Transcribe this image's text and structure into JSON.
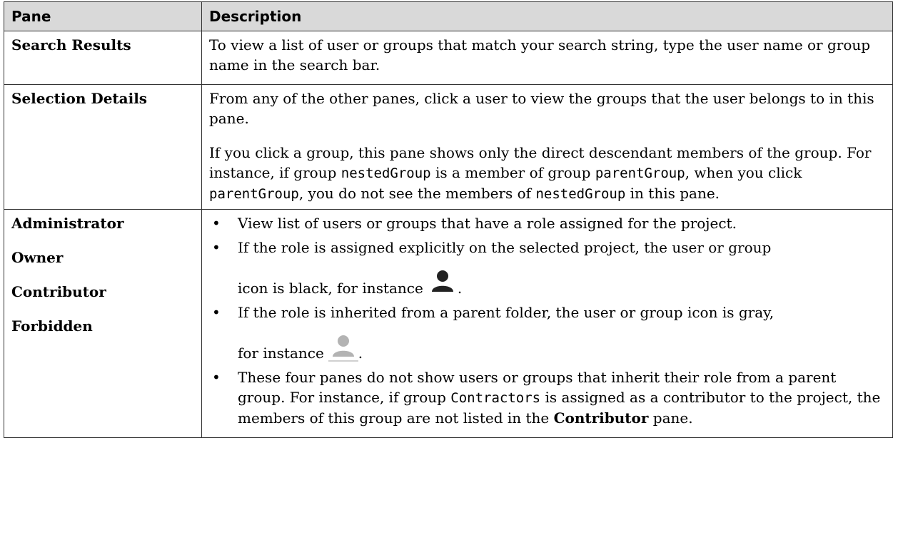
{
  "headers": {
    "pane": "Pane",
    "description": "Description"
  },
  "rows": {
    "search": {
      "pane": "Search Results",
      "description": "To view a list of user or groups that match your search string, type the user name or group name in the search bar."
    },
    "selection": {
      "pane": "Selection Details",
      "p1": "From any of the other panes, click a user to view the groups that the user belongs to in this pane.",
      "p2_a": "If you click a group, this pane shows only the direct descendant members of the group. For instance, if group ",
      "p2_code1": "nestedGroup",
      "p2_b": " is a member of group ",
      "p2_code2": "parentGroup",
      "p2_c": ", when you click ",
      "p2_code3": "parentGroup",
      "p2_d": ", you do not see the members of ",
      "p2_code4": "nestedGroup",
      "p2_e": " in this pane."
    },
    "roles": {
      "panes": [
        "Administrator",
        "Owner",
        "Contributor",
        "Forbidden"
      ],
      "b1": "View list of users or groups that have a role assigned for the project.",
      "b2_a": "If the role is assigned explicitly on the selected project, the user or group",
      "b2_b": "icon is black, for instance",
      "b2_end": ".",
      "b3_a": "If the role is inherited from a parent folder, the user or group icon is gray,",
      "b3_b": "for instance",
      "b3_end": ".",
      "b4_a": "These four panes do not show users or groups that inherit their role from a parent group. For instance, if group ",
      "b4_code": "Contractors",
      "b4_b": " is assigned as a contributor to the project, the members of this group are not listed in the ",
      "b4_bold": "Contributor",
      "b4_c": " pane."
    }
  },
  "icons": {
    "explicit": "user-black-icon",
    "inherited": "user-gray-icon"
  },
  "colors": {
    "header_bg": "#d9d9d9",
    "icon_black": "#222222",
    "icon_gray": "#b3b3b3"
  }
}
